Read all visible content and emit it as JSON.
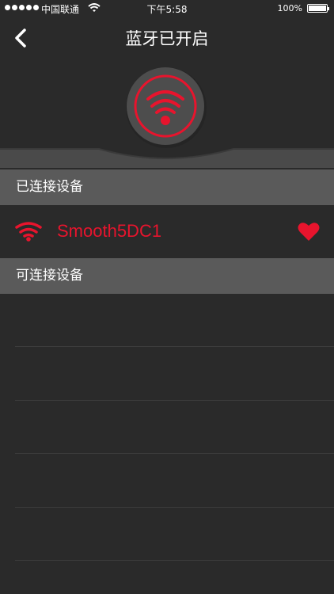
{
  "status_bar": {
    "carrier": "中国联通",
    "time": "下午5:58",
    "battery": "100%"
  },
  "nav": {
    "title": "蓝牙已开启",
    "back_icon": "chevron-left-icon"
  },
  "hero": {
    "icon": "wifi-icon"
  },
  "sections": {
    "connected": "已连接设备",
    "available": "可连接设备"
  },
  "connected_devices": [
    {
      "name": "Smooth5DC1",
      "signal_icon": "wifi-icon",
      "favorite_icon": "heart-icon"
    }
  ],
  "colors": {
    "accent": "#e8142d",
    "background": "#2a2a2a",
    "section_header": "#5a5a5a",
    "hero_circle": "#4d4d4d"
  }
}
